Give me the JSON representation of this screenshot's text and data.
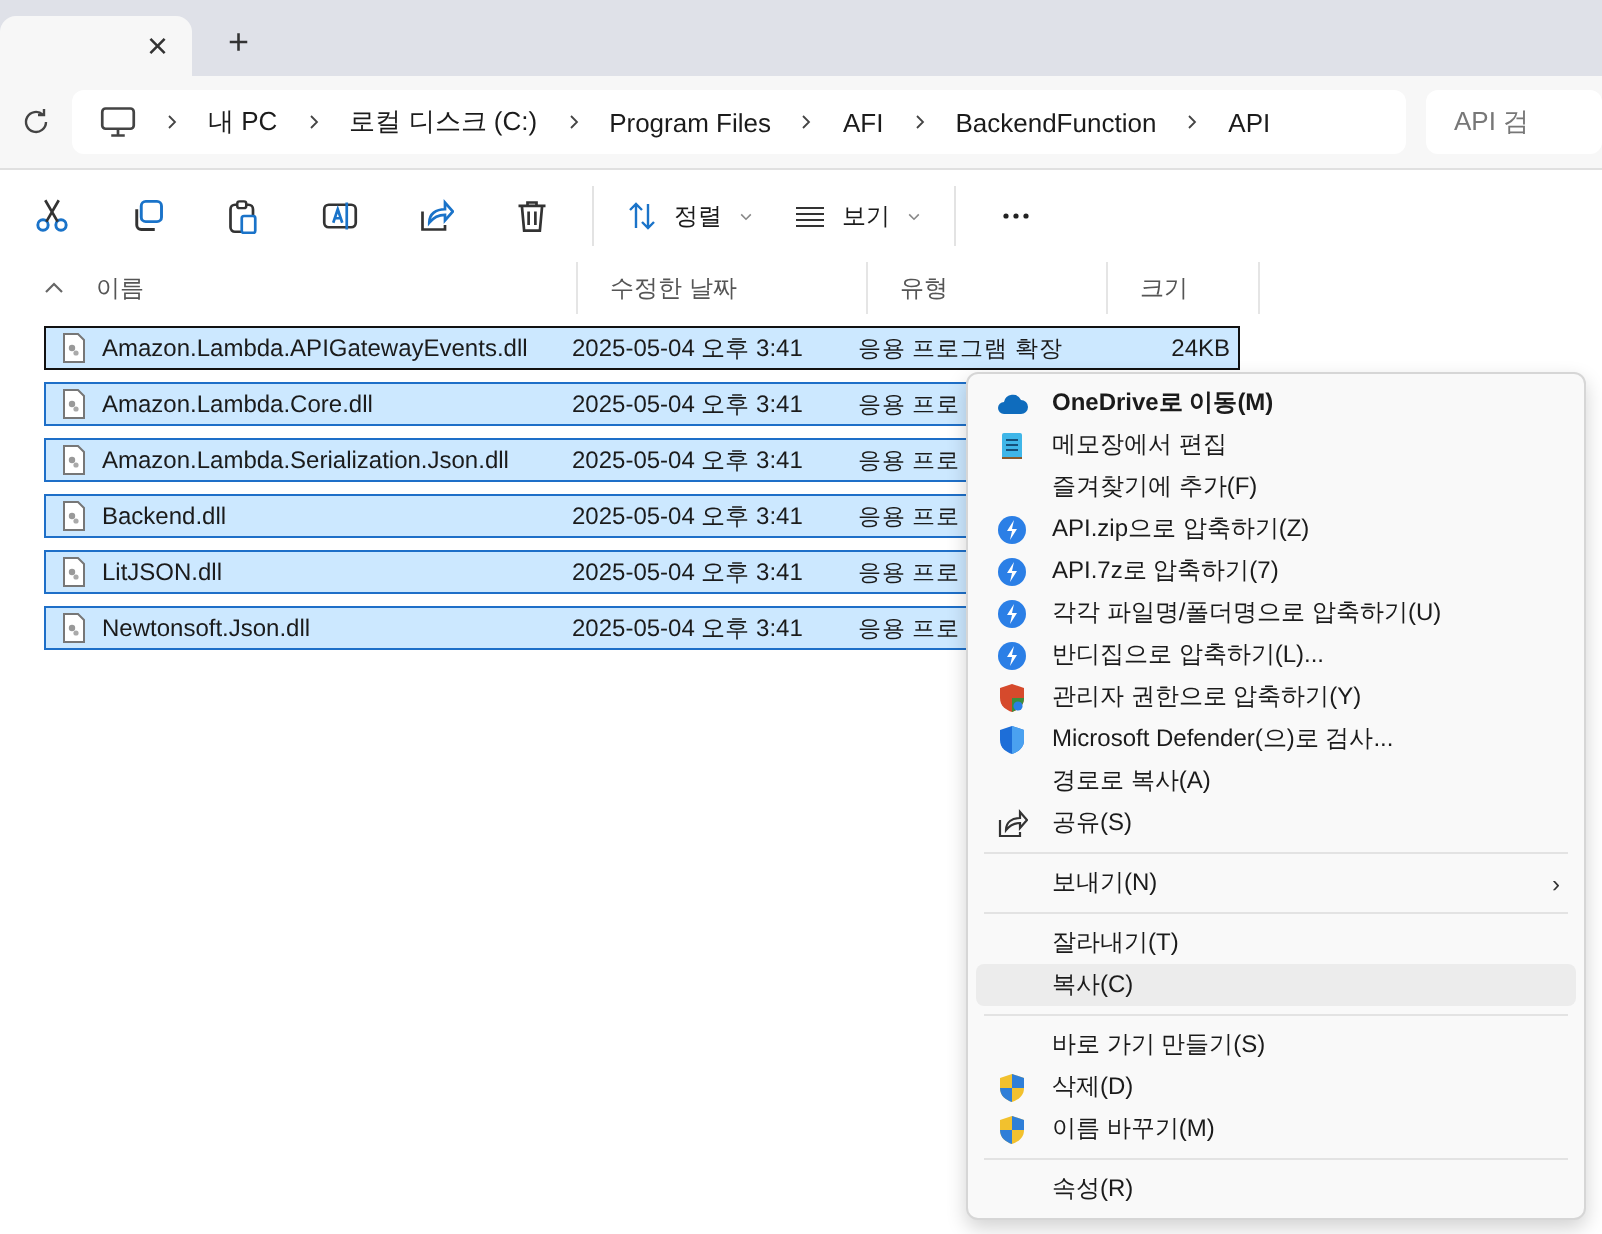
{
  "tab_bar": {
    "close_glyph": "×",
    "new_tab_glyph": "+"
  },
  "address_bar": {
    "breadcrumbs": [
      "내 PC",
      "로컬 디스크 (C:)",
      "Program Files",
      "AFI",
      "BackendFunction",
      "API"
    ],
    "search_placeholder": "API 검"
  },
  "toolbar": {
    "buttons": [
      {
        "kind": "cut"
      },
      {
        "kind": "copy"
      },
      {
        "kind": "paste"
      },
      {
        "kind": "rename"
      },
      {
        "kind": "share"
      },
      {
        "kind": "delete"
      }
    ],
    "sort_label": "정렬",
    "view_label": "보기"
  },
  "table": {
    "columns": [
      "이름",
      "수정한 날짜",
      "유형",
      "크기"
    ],
    "rows": [
      {
        "name": "Amazon.Lambda.APIGatewayEvents.dll",
        "date": "2025-05-04 오후 3:41",
        "type": "응용 프로그램 확장",
        "size": "24KB",
        "selected": true,
        "focused": true
      },
      {
        "name": "Amazon.Lambda.Core.dll",
        "date": "2025-05-04 오후 3:41",
        "type": "응용 프로",
        "selected": true,
        "focused": false
      },
      {
        "name": "Amazon.Lambda.Serialization.Json.dll",
        "date": "2025-05-04 오후 3:41",
        "type": "응용 프로",
        "selected": true,
        "focused": false
      },
      {
        "name": "Backend.dll",
        "date": "2025-05-04 오후 3:41",
        "type": "응용 프로",
        "selected": true,
        "focused": false
      },
      {
        "name": "LitJSON.dll",
        "date": "2025-05-04 오후 3:41",
        "type": "응용 프로",
        "selected": true,
        "focused": false
      },
      {
        "name": "Newtonsoft.Json.dll",
        "date": "2025-05-04 오후 3:41",
        "type": "응용 프로",
        "selected": true,
        "focused": false
      }
    ]
  },
  "context_menu": {
    "items": [
      {
        "kind": "item",
        "label": "OneDrive로 이동(M)",
        "default": true,
        "selected": false
      },
      {
        "kind": "item",
        "label": "메모장에서 편집",
        "default": false,
        "selected": false
      },
      {
        "kind": "item",
        "label": "즐겨찾기에 추가(F)",
        "default": false,
        "selected": false
      },
      {
        "kind": "item",
        "label": "API.zip으로 압축하기(Z)",
        "default": false,
        "selected": false
      },
      {
        "kind": "item",
        "label": "API.7z로 압축하기(7)",
        "default": false,
        "selected": false
      },
      {
        "kind": "item",
        "label": "각각 파일명/폴더명으로 압축하기(U)",
        "default": false,
        "selected": false
      },
      {
        "kind": "item",
        "label": "반디집으로 압축하기(L)...",
        "default": false,
        "selected": false
      },
      {
        "kind": "item",
        "label": "관리자 권한으로 압축하기(Y)",
        "default": false,
        "selected": false
      },
      {
        "kind": "item",
        "label": "Microsoft Defender(으)로 검사...",
        "default": false,
        "selected": false
      },
      {
        "kind": "item",
        "label": "경로로 복사(A)",
        "default": false,
        "selected": false
      },
      {
        "kind": "item",
        "label": "공유(S)",
        "default": false,
        "selected": false
      },
      {
        "kind": "separator"
      },
      {
        "kind": "item",
        "label": "보내기(N)",
        "default": false,
        "selected": false,
        "submenu_glyph": "›"
      },
      {
        "kind": "separator"
      },
      {
        "kind": "item",
        "label": "잘라내기(T)",
        "default": false,
        "selected": false
      },
      {
        "kind": "item",
        "label": "복사(C)",
        "default": false,
        "selected": true
      },
      {
        "kind": "separator"
      },
      {
        "kind": "item",
        "label": "바로 가기 만들기(S)",
        "default": false,
        "selected": false
      },
      {
        "kind": "item",
        "label": "삭제(D)",
        "default": false,
        "selected": false
      },
      {
        "kind": "item",
        "label": "이름 바꾸기(M)",
        "default": false,
        "selected": false
      },
      {
        "kind": "separator"
      },
      {
        "kind": "item",
        "label": "속성(R)",
        "default": false,
        "selected": false
      }
    ]
  }
}
